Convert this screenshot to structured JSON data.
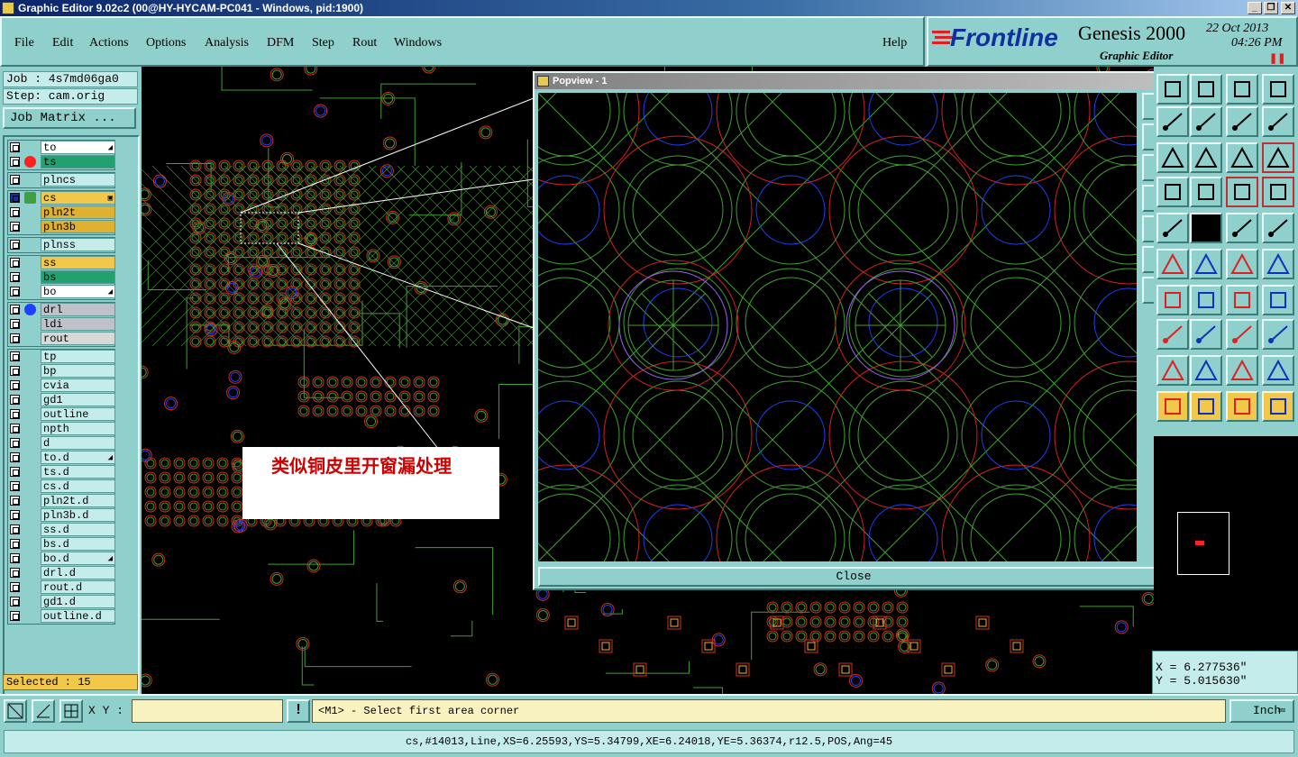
{
  "window": {
    "title": "Graphic Editor 9.02c2 (00@HY-HYCAM-PC041 - Windows, pid:1900)",
    "minimize": "_",
    "restore": "❐",
    "close": "✕"
  },
  "menu": {
    "items": [
      "File",
      "Edit",
      "Actions",
      "Options",
      "Analysis",
      "DFM",
      "Step",
      "Rout",
      "Windows"
    ],
    "help": "Help"
  },
  "logo": {
    "brand": "Frontline",
    "product": "Genesis 2000",
    "subtitle": "Graphic Editor",
    "date": "22 Oct 2013",
    "time": "04:26 PM"
  },
  "job": {
    "job_label": "Job : 4s7md06ga0",
    "step_label": "Step: cam.orig",
    "matrix_button": "Job Matrix ..."
  },
  "layers": [
    {
      "name": "to",
      "color": "#ffffff",
      "flag": "◢"
    },
    {
      "name": "ts",
      "color": "#22a070",
      "dot": "#ff2020"
    },
    {
      "name": "plncs",
      "color": "#c4ecea"
    },
    {
      "name": "cs",
      "color": "#f2c84a",
      "flag": "▣"
    },
    {
      "name": "pln2t",
      "color": "#e0b030"
    },
    {
      "name": "pln3b",
      "color": "#e0b030"
    },
    {
      "name": "plnss",
      "color": "#c4ecea"
    },
    {
      "name": "ss",
      "color": "#f2c84a"
    },
    {
      "name": "bs",
      "color": "#22a070"
    },
    {
      "name": "bo",
      "color": "#ffffff",
      "flag": "◢"
    },
    {
      "name": "drl",
      "color": "#c0c0c8",
      "dot": "#2040ff"
    },
    {
      "name": "ldi",
      "color": "#c0c0c8"
    },
    {
      "name": "rout",
      "color": "#d8d8d8"
    },
    {
      "name": "tp",
      "color": "#c4ecea"
    },
    {
      "name": "bp",
      "color": "#c4ecea"
    },
    {
      "name": "cvia",
      "color": "#c4ecea"
    },
    {
      "name": "gd1",
      "color": "#c4ecea"
    },
    {
      "name": "outline",
      "color": "#c4ecea"
    },
    {
      "name": "npth",
      "color": "#c4ecea"
    },
    {
      "name": "d",
      "color": "#c4ecea"
    },
    {
      "name": "to.d",
      "color": "#c4ecea",
      "flag": "◢"
    },
    {
      "name": "ts.d",
      "color": "#c4ecea"
    },
    {
      "name": "cs.d",
      "color": "#c4ecea"
    },
    {
      "name": "pln2t.d",
      "color": "#c4ecea"
    },
    {
      "name": "pln3b.d",
      "color": "#c4ecea"
    },
    {
      "name": "ss.d",
      "color": "#c4ecea"
    },
    {
      "name": "bs.d",
      "color": "#c4ecea"
    },
    {
      "name": "bo.d",
      "color": "#c4ecea",
      "flag": "◢"
    },
    {
      "name": "drl.d",
      "color": "#c4ecea"
    },
    {
      "name": "rout.d",
      "color": "#c4ecea"
    },
    {
      "name": "gd1.d",
      "color": "#c4ecea"
    },
    {
      "name": "outline.d",
      "color": "#c4ecea"
    }
  ],
  "selected": "Selected : 15",
  "popview": {
    "title": "Popview - 1",
    "close_button": "Close"
  },
  "annotation": "类似铜皮里开窗漏处理",
  "coordinates": {
    "x": "X = 6.277536\"",
    "y": "Y = 5.015630\""
  },
  "bottom": {
    "xy_label": "X Y :",
    "xy_value": "",
    "warning_icon": "!",
    "prompt": "<M1> - Select first area corner",
    "units": "Inch"
  },
  "status": "cs,#14013,Line,XS=6.25593,YS=5.34799,XE=6.24018,YE=5.36374,r12.5,POS,Ang=45"
}
